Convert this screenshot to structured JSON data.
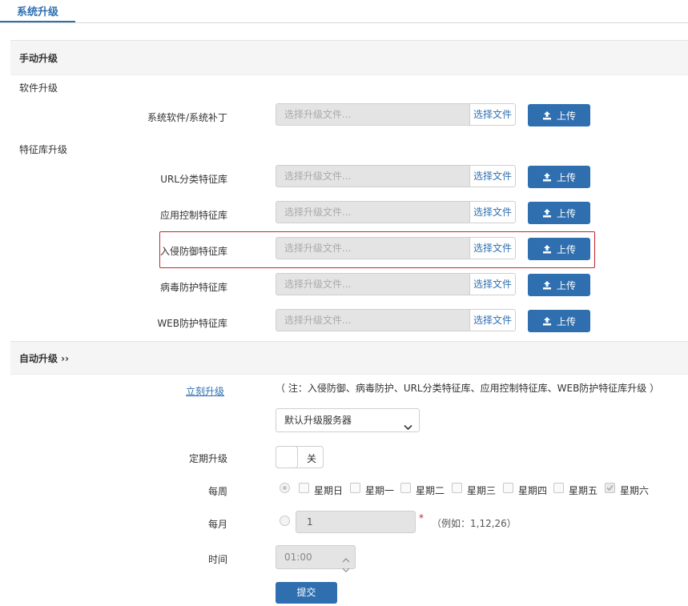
{
  "tab": {
    "label": "系统升级"
  },
  "manual": {
    "title": "手动升级",
    "software_group": "软件升级",
    "signature_group": "特征库升级",
    "rows": [
      {
        "label": "系统软件/系统补丁",
        "placeholder": "选择升级文件...",
        "choose": "选择文件",
        "upload": "上传"
      },
      {
        "label": "URL分类特征库",
        "placeholder": "选择升级文件...",
        "choose": "选择文件",
        "upload": "上传"
      },
      {
        "label": "应用控制特征库",
        "placeholder": "选择升级文件...",
        "choose": "选择文件",
        "upload": "上传"
      },
      {
        "label": "入侵防御特征库",
        "placeholder": "选择升级文件...",
        "choose": "选择文件",
        "upload": "上传"
      },
      {
        "label": "病毒防护特征库",
        "placeholder": "选择升级文件...",
        "choose": "选择文件",
        "upload": "上传"
      },
      {
        "label": "WEB防护特征库",
        "placeholder": "选择升级文件...",
        "choose": "选择文件",
        "upload": "上传"
      }
    ]
  },
  "auto": {
    "title": "自动升级 ››",
    "immediate_link": "立刻升级",
    "note": "（ 注：入侵防御、病毒防护、URL分类特征库、应用控制特征库、WEB防护特征库升级 ）",
    "server_select": "默认升级服务器",
    "schedule_label": "定期升级",
    "schedule_toggle": "关",
    "weekly_label": "每周",
    "weekdays": [
      {
        "label": "星期日",
        "checked": false
      },
      {
        "label": "星期一",
        "checked": false
      },
      {
        "label": "星期二",
        "checked": false
      },
      {
        "label": "星期三",
        "checked": false
      },
      {
        "label": "星期四",
        "checked": false
      },
      {
        "label": "星期五",
        "checked": false
      },
      {
        "label": "星期六",
        "checked": true
      }
    ],
    "monthly_label": "每月",
    "monthly_value": "1",
    "monthly_required": "*",
    "monthly_example": "（例如：1,12,26）",
    "time_label": "时间",
    "time_value": "01:00",
    "submit": "提交"
  },
  "colors": {
    "accent": "#2f6fb0",
    "highlight": "#c0272d"
  }
}
